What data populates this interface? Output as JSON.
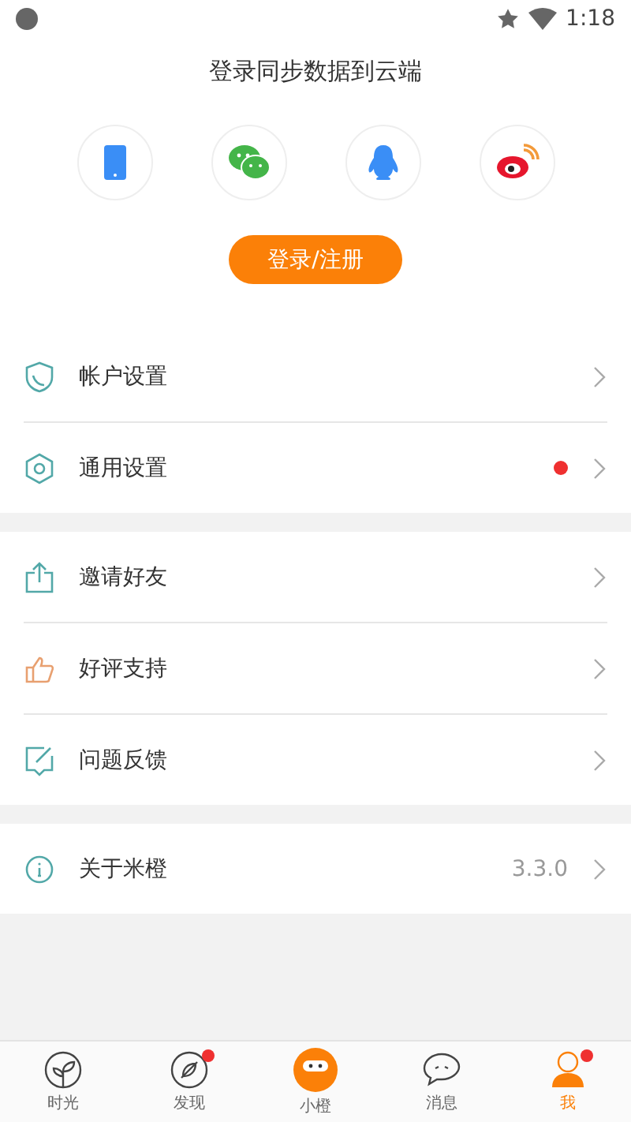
{
  "status_bar": {
    "time": "1:18"
  },
  "login": {
    "title": "登录同步数据到云端",
    "methods": [
      {
        "kind": "phone"
      },
      {
        "kind": "wechat"
      },
      {
        "kind": "qq"
      },
      {
        "kind": "weibo"
      }
    ],
    "button": "登录/注册"
  },
  "sections": [
    {
      "items": [
        {
          "kind": "shield",
          "label": "帐户设置",
          "dot": false
        },
        {
          "kind": "hexagon",
          "label": "通用设置",
          "dot": true
        }
      ]
    },
    {
      "items": [
        {
          "kind": "share",
          "label": "邀请好友",
          "dot": false
        },
        {
          "kind": "thumb",
          "label": "好评支持",
          "dot": false
        },
        {
          "kind": "feedback",
          "label": "问题反馈",
          "dot": false
        }
      ]
    },
    {
      "items": [
        {
          "kind": "info",
          "label": "关于米橙",
          "dot": false,
          "value": "3.3.0"
        }
      ]
    }
  ],
  "tabs": [
    {
      "kind": "leaf",
      "label": "时光",
      "selected": false,
      "dot": false
    },
    {
      "kind": "compass",
      "label": "发现",
      "selected": false,
      "dot": true
    },
    {
      "kind": "mascot",
      "label": "小橙",
      "selected": false,
      "dot": false
    },
    {
      "kind": "chat",
      "label": "消息",
      "selected": false,
      "dot": false
    },
    {
      "kind": "person",
      "label": "我",
      "selected": true,
      "dot": true
    }
  ]
}
